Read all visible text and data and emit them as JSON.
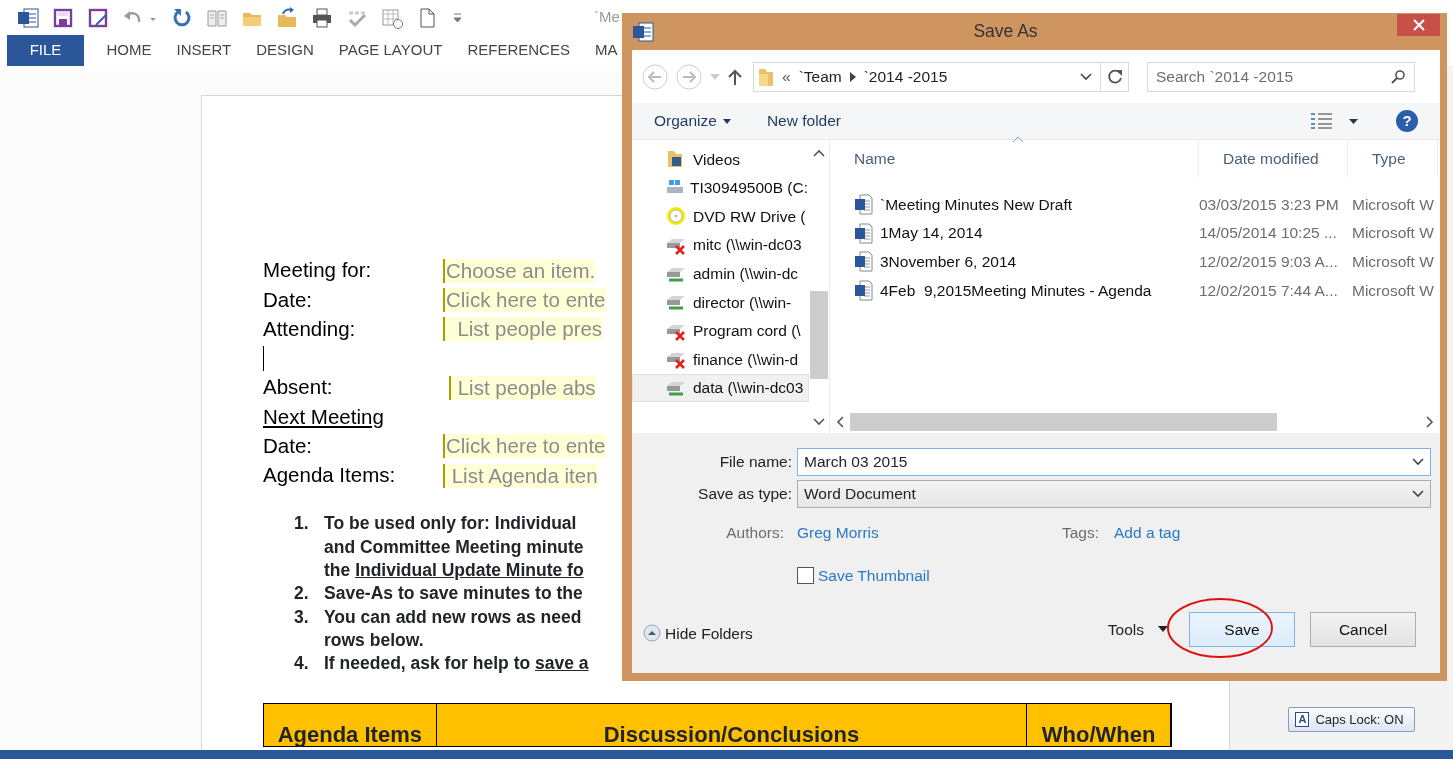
{
  "word_window": {
    "title_fragment": "`Me",
    "ribbon_tabs": [
      {
        "label": "FILE",
        "kind": "file"
      },
      {
        "label": "HOME",
        "kind": "tab"
      },
      {
        "label": "INSERT",
        "kind": "tab"
      },
      {
        "label": "DESIGN",
        "kind": "tab"
      },
      {
        "label": "PAGE LAYOUT",
        "kind": "tab"
      },
      {
        "label": "REFERENCES",
        "kind": "tab"
      },
      {
        "label": "MA",
        "kind": "tab"
      }
    ],
    "document": {
      "fields": [
        {
          "label": "Meeting for:",
          "placeholder": "Choose an item."
        },
        {
          "label": "Date:",
          "placeholder": "Click here to ente"
        },
        {
          "label": "Attending:",
          "placeholder": "  List people pres"
        },
        {
          "kind": "caret"
        },
        {
          "label": "Absent:",
          "placeholder": " List people abs"
        },
        {
          "kind": "heading",
          "label": "Next Meeting"
        },
        {
          "label": "Date:",
          "placeholder": "Click here to ente"
        },
        {
          "label": "Agenda Items:",
          "placeholder": " List Agenda iten"
        }
      ],
      "instructions": [
        {
          "number": "1.",
          "lines": [
            [
              {
                "text": "To be used only for: Individual",
                "underline": false
              }
            ],
            [
              {
                "text": "and Committee Meeting minute",
                "underline": false
              }
            ],
            [
              {
                "text": "the ",
                "underline": false
              },
              {
                "text": "Individual Update Minute fo",
                "underline": true
              }
            ]
          ]
        },
        {
          "number": "2.",
          "lines": [
            [
              {
                "text": "Save-As to save minutes to the",
                "underline": false
              }
            ]
          ]
        },
        {
          "number": "3.",
          "lines": [
            [
              {
                "text": "You can add new rows as need",
                "underline": false
              }
            ],
            [
              {
                "text": "rows below.",
                "underline": false
              }
            ]
          ]
        },
        {
          "number": "4.",
          "lines": [
            [
              {
                "text": "If needed, ask for help to ",
                "underline": false
              },
              {
                "text": "save a",
                "underline": true
              }
            ]
          ]
        }
      ],
      "table": {
        "columns": [
          "Agenda Items",
          "Discussion/Conclusions",
          "Who/When"
        ]
      }
    },
    "caps_lock": {
      "key": "A",
      "label": "Caps Lock: ON"
    }
  },
  "save_as_dialog": {
    "title": "Save As",
    "address": {
      "overflow": "«",
      "crumbs": [
        "`Team",
        "`2014 -2015"
      ]
    },
    "help": "?",
    "search": {
      "placeholder": "Search `2014 -2015"
    },
    "toolbar": [
      {
        "label": "Organize",
        "dropdown": true
      },
      {
        "label": "New folder",
        "dropdown": false
      }
    ],
    "nav_items": [
      {
        "label": "Videos",
        "kind": "folder",
        "selected": false
      },
      {
        "label": "TI30949500B (C:",
        "kind": "drive",
        "selected": false
      },
      {
        "label": "DVD RW Drive (",
        "kind": "dvd",
        "selected": false
      },
      {
        "label": "mitc (\\\\win-dc03",
        "kind": "network_offline",
        "selected": false
      },
      {
        "label": "admin (\\\\win-dc",
        "kind": "network",
        "selected": false
      },
      {
        "label": "director (\\\\win-",
        "kind": "network",
        "selected": false
      },
      {
        "label": "Program cord (\\",
        "kind": "network_offline",
        "selected": false
      },
      {
        "label": "finance (\\\\win-d",
        "kind": "network_offline",
        "selected": false
      },
      {
        "label": "data (\\\\win-dc03",
        "kind": "network",
        "selected": true
      }
    ],
    "columns": [
      "Name",
      "Date modified",
      "Type"
    ],
    "files": [
      {
        "name": "`Meeting Minutes New Draft",
        "date": "03/03/2015 3:23 PM",
        "type": "Microsoft W"
      },
      {
        "name": "1May 14, 2014",
        "date": "14/05/2014 10:25 ...",
        "type": "Microsoft W"
      },
      {
        "name": "3November 6, 2014",
        "date": "12/02/2015 9:03 A...",
        "type": "Microsoft W"
      },
      {
        "name": "4Feb  9,2015Meeting Minutes - Agenda",
        "date": "12/02/2015 7:44 A...",
        "type": "Microsoft W"
      }
    ],
    "file_name": {
      "label": "File name:",
      "value": "March 03 2015"
    },
    "save_as_type": {
      "label": "Save as type:",
      "value": "Word Document"
    },
    "authors": {
      "label": "Authors:",
      "value": "Greg Morris"
    },
    "tags": {
      "label": "Tags:",
      "value": "Add a tag"
    },
    "save_thumbnail": {
      "label": "Save Thumbnail",
      "checked": false
    },
    "hide_folders": "Hide Folders",
    "tools": "Tools",
    "buttons": [
      {
        "label": "Save",
        "kind": "primary",
        "circled": true
      },
      {
        "label": "Cancel",
        "kind": "secondary",
        "circled": false
      }
    ]
  }
}
